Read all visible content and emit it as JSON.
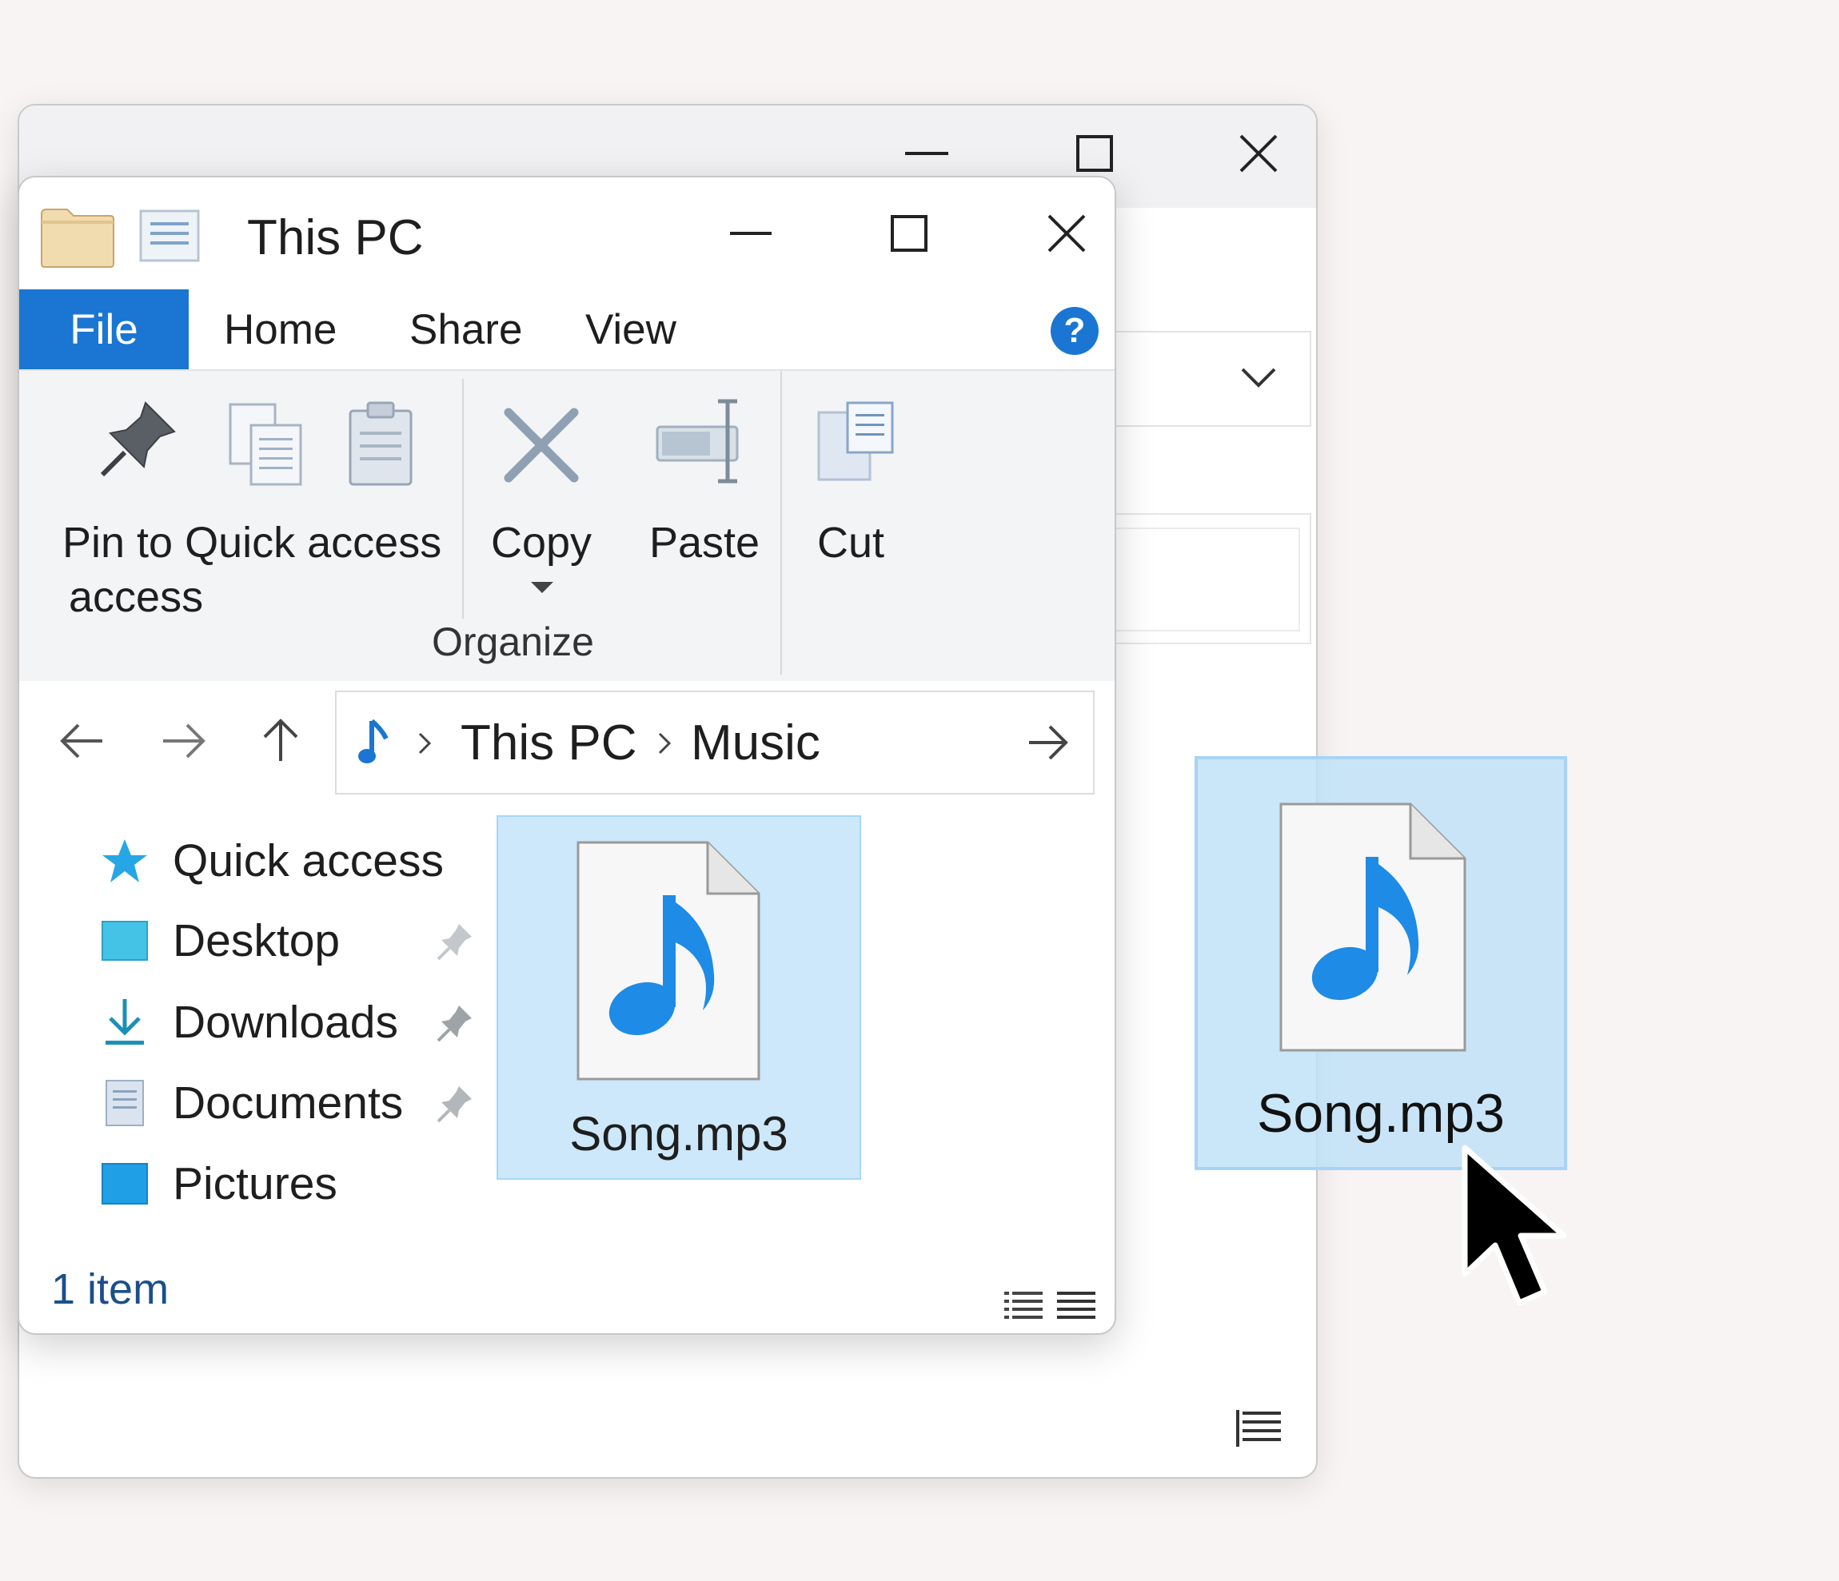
{
  "front_window": {
    "title": "This PC",
    "tabs": [
      {
        "label": "File"
      },
      {
        "label": "Home"
      },
      {
        "label": "Share"
      },
      {
        "label": "View"
      }
    ],
    "help_label": "?",
    "ribbon": {
      "pin_line1": "Pin to Quick access",
      "pin_line2": "access",
      "copy_label": "Copy",
      "paste_label": "Paste",
      "cut_label": "Cut",
      "group_label": "Organize"
    },
    "address": {
      "crumbs": [
        "This PC",
        "Music"
      ]
    },
    "nav": [
      {
        "label": "Quick access",
        "icon": "star-icon"
      },
      {
        "label": "Desktop",
        "icon": "desktop-folder-icon",
        "pinned": true
      },
      {
        "label": "Downloads",
        "icon": "download-arrow-icon",
        "pinned": true
      },
      {
        "label": "Documents",
        "icon": "documents-icon",
        "pinned": true
      },
      {
        "label": "Pictures",
        "icon": "pictures-folder-icon"
      }
    ],
    "file": {
      "name": "Song.mp3",
      "icon": "music-file-icon",
      "selected": true
    },
    "status": "1 item"
  },
  "drag_ghost": {
    "name": "Song.mp3",
    "icon": "music-file-icon"
  },
  "colors": {
    "accent": "#1a76d2",
    "selection": "#cce8fa",
    "music_note": "#1e8be6"
  }
}
